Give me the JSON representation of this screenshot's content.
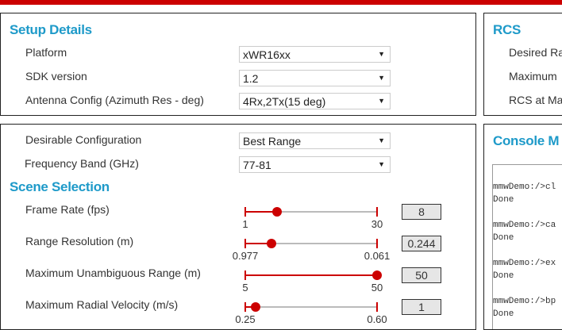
{
  "setup": {
    "title": "Setup Details",
    "rows": [
      {
        "label": "Platform",
        "value": "xWR16xx"
      },
      {
        "label": "SDK version",
        "value": "1.2"
      },
      {
        "label": "Antenna Config (Azimuth Res - deg)",
        "value": "4Rx,2Tx(15 deg)"
      }
    ]
  },
  "rcs": {
    "title": "RCS",
    "rows": [
      "Desired Ra",
      "Maximum",
      "RCS at Ma"
    ]
  },
  "config": {
    "rows": [
      {
        "label": "Desirable Configuration",
        "value": "Best Range"
      },
      {
        "label": "Frequency Band (GHz)",
        "value": "77-81"
      }
    ]
  },
  "scene": {
    "title": "Scene Selection",
    "sliders": [
      {
        "label": "Frame Rate (fps)",
        "min": "1",
        "max": "30",
        "value": "8",
        "fraction": 0.24
      },
      {
        "label": "Range Resolution (m)",
        "min": "0.977",
        "max": "0.061",
        "value": "0.244",
        "fraction": 0.2
      },
      {
        "label": "Maximum Unambiguous Range (m)",
        "min": "5",
        "max": "50",
        "value": "50",
        "fraction": 1.0
      },
      {
        "label": "Maximum Radial Velocity (m/s)",
        "min": "0.25",
        "max": "0.60",
        "value": "1",
        "fraction": 0.08
      }
    ]
  },
  "console": {
    "title": "Console M",
    "lines": [
      "mmwDemo:/>cl",
      "Done",
      "",
      "mmwDemo:/>ca",
      "Done",
      "",
      "mmwDemo:/>ex",
      "Done",
      "",
      "mmwDemo:/>bp",
      "Done"
    ]
  }
}
